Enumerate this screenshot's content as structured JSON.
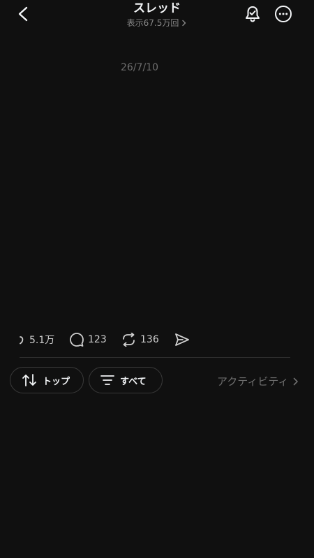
{
  "header": {
    "title": "スレッド",
    "views_label": "表示67.5万回",
    "icons": {
      "back": "back-chevron-icon",
      "views_arrow": "chevron-right-icon",
      "notify": "bell-check-icon",
      "more": "more-options-icon"
    }
  },
  "post": {
    "date": "26/7/10"
  },
  "actions": {
    "likes": "5.1万",
    "comments": "123",
    "reposts": "136",
    "icons": [
      "heart-icon",
      "comment-icon",
      "repost-icon",
      "share-icon"
    ]
  },
  "sort_bar": {
    "top_label": "トップ",
    "all_label": "すべて",
    "activity_label": "アクティビティ",
    "icons": [
      "sort-arrows-icon",
      "filter-lines-icon",
      "chevron-right-icon"
    ]
  },
  "colors": {
    "background": "#101010",
    "text": "#f3f5f7",
    "muted": "#6e6e6e",
    "border": "#3a3a3a"
  }
}
